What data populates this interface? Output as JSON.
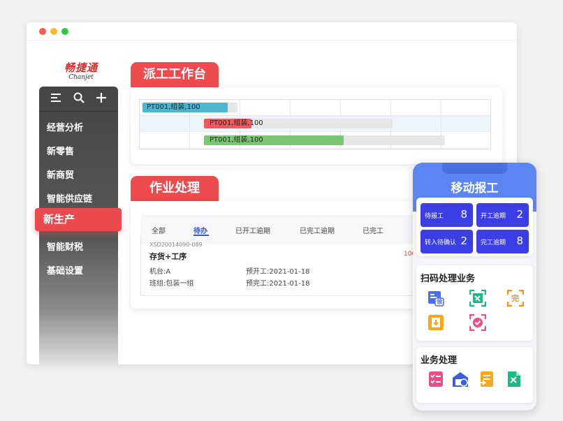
{
  "brand": {
    "name_cn": "畅捷通",
    "name_en": "Chanjet"
  },
  "sidebar": {
    "items": [
      {
        "label": "经营分析"
      },
      {
        "label": "新零售"
      },
      {
        "label": "新商贸"
      },
      {
        "label": "智能供应链"
      },
      {
        "label": "新生产"
      },
      {
        "label": "智能财税"
      },
      {
        "label": "基础设置"
      }
    ],
    "active_index": 4
  },
  "dispatch": {
    "title": "派工工作台",
    "bars": [
      {
        "label": "PT001,组装,100",
        "color": "#4db6ce",
        "progress": 0.9
      },
      {
        "label": "PT001,组装,100",
        "color": "#ee5a5e",
        "progress": 0.25
      },
      {
        "label": "PT001,组装,100",
        "color": "#7bc674",
        "progress": 0.58
      }
    ]
  },
  "work": {
    "title": "作业处理",
    "tabs": [
      "全部",
      "待办",
      "已开工逾期",
      "已完工逾期",
      "已完工"
    ],
    "active_tab": 1,
    "task": {
      "code": "XSD20014090-089",
      "name": "存货+工序",
      "qty": "100",
      "machine": "机台:A",
      "team": "班组:包装一组",
      "plan_start": "预开工:2021-01-18",
      "plan_finish": "预完工:2021-01-18"
    }
  },
  "mobile": {
    "title": "移动报工",
    "stats": [
      {
        "label": "待报工",
        "value": "8"
      },
      {
        "label": "开工逾期",
        "value": "2"
      },
      {
        "label": "转入待确认",
        "value": "2"
      },
      {
        "label": "完工逾期",
        "value": "8"
      }
    ],
    "scan": {
      "title": "扫码处理业务",
      "icons": [
        "receive-material-icon",
        "scan-icon",
        "complete-icon",
        "return-icon",
        "confirm-icon"
      ],
      "icon_text": {
        "receive": "领",
        "complete": "完"
      }
    },
    "business": {
      "title": "业务处理",
      "icons": [
        "checklist-icon",
        "warehouse-icon",
        "transfer-icon",
        "document-tools-icon"
      ]
    }
  },
  "colors": {
    "accent_red": "#ee4b4f",
    "brand_red": "#e12b2b",
    "mobile_blue": "#5b85f0",
    "tile_blue": "#3d3de6",
    "tab_blue": "#3156d8"
  }
}
